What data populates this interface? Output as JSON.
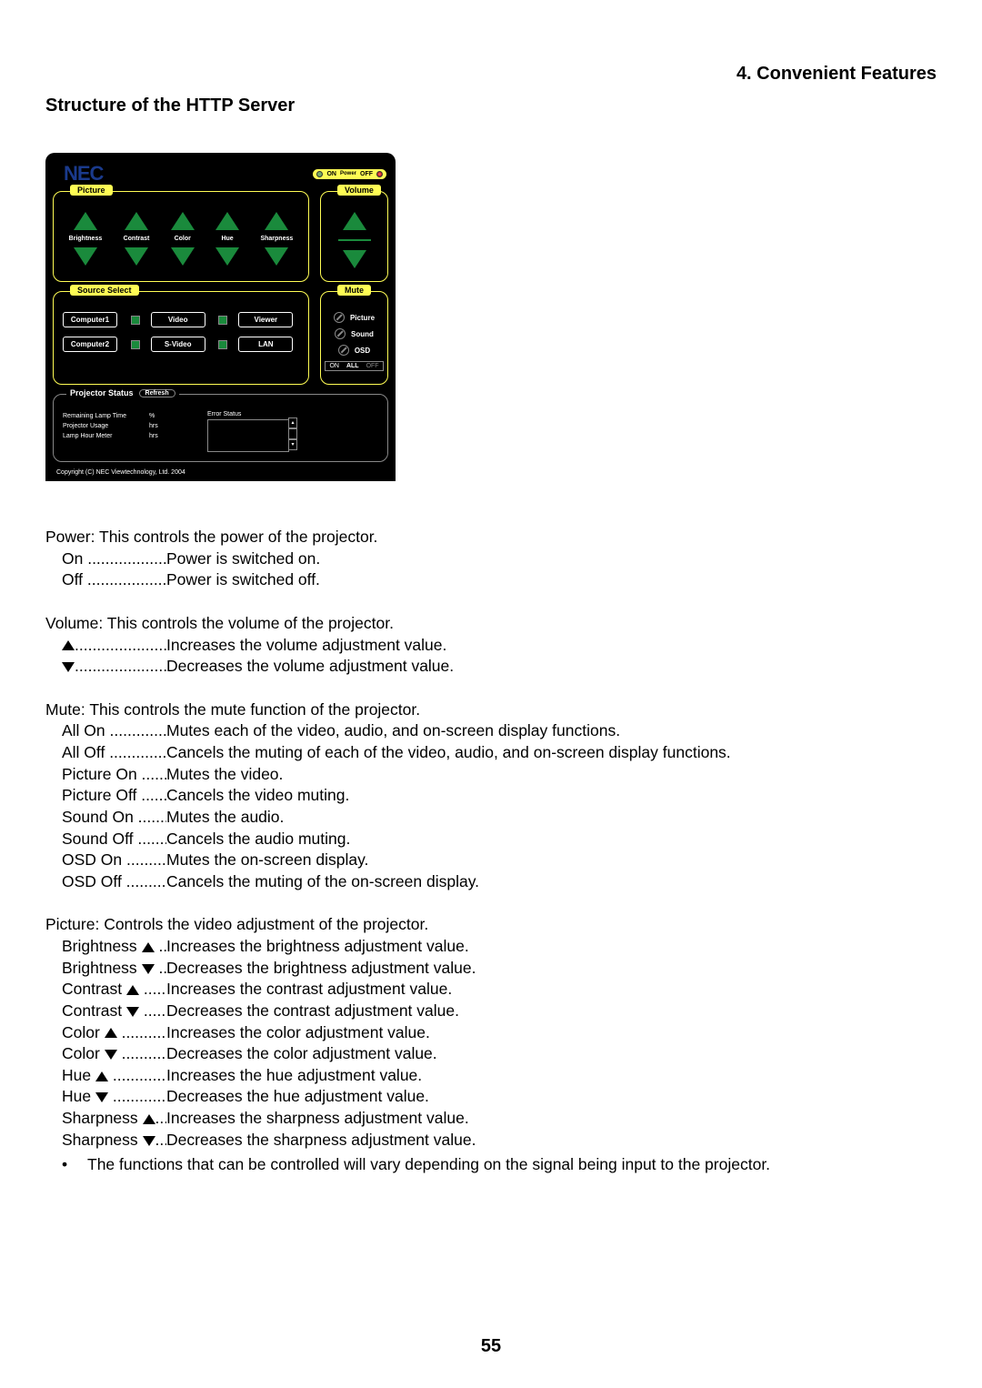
{
  "header": {
    "chapter": "4. Convenient Features",
    "section": "Structure of the HTTP Server"
  },
  "ui": {
    "logo": "NEC",
    "power": {
      "on": "ON",
      "label": "Power",
      "off": "OFF"
    },
    "picture": {
      "title": "Picture",
      "items": [
        "Brightness",
        "Contrast",
        "Color",
        "Hue",
        "Sharpness"
      ]
    },
    "volume": {
      "title": "Volume"
    },
    "source": {
      "title": "Source Select",
      "buttons": [
        "Computer1",
        "Video",
        "Viewer",
        "Computer2",
        "S-Video",
        "LAN"
      ]
    },
    "mute": {
      "title": "Mute",
      "items": [
        "Picture",
        "Sound",
        "OSD"
      ],
      "all": {
        "on": "ON",
        "all": "ALL",
        "off": "OFF"
      }
    },
    "status": {
      "title": "Projector Status",
      "refresh": "Refresh",
      "rows": [
        {
          "label": "Remaining Lamp Time",
          "unit": "%"
        },
        {
          "label": "Projector Usage",
          "unit": "hrs"
        },
        {
          "label": "Lamp Hour Meter",
          "unit": "hrs"
        }
      ],
      "error": "Error Status"
    },
    "copyright": "Copyright (C) NEC Viewtechnology, Ltd. 2004"
  },
  "text": {
    "power": {
      "head": "Power: This controls the power of the projector.",
      "rows": [
        {
          "term": "On ...................",
          "desc": "Power is switched on."
        },
        {
          "term": "Off ...................",
          "desc": "Power is switched off."
        }
      ]
    },
    "volume": {
      "head": "Volume: This controls the volume of the projector.",
      "rows": [
        {
          "sym": "up",
          "dots": ".....................",
          "desc": "Increases the volume adjustment value."
        },
        {
          "sym": "down",
          "dots": ".....................",
          "desc": "Decreases the volume adjustment value."
        }
      ]
    },
    "mute": {
      "head": "Mute: This controls the mute function of the projector.",
      "rows": [
        {
          "term": "All On ..............",
          "desc": "Mutes each of the video, audio, and on-screen display functions."
        },
        {
          "term": "All Off ..............",
          "desc": "Cancels the muting of each of the video, audio, and on-screen display functions."
        },
        {
          "term": "Picture On .......",
          "desc": "Mutes the video."
        },
        {
          "term": "Picture Off .......",
          "desc": "Cancels the video muting."
        },
        {
          "term": "Sound On ........",
          "desc": "Mutes the audio."
        },
        {
          "term": "Sound Off ........",
          "desc": "Cancels the audio muting."
        },
        {
          "term": "OSD On ..........",
          "desc": "Mutes the on-screen display."
        },
        {
          "term": "OSD Off ..........",
          "desc": "Cancels the muting of the on-screen display."
        }
      ]
    },
    "picture": {
      "head": "Picture: Controls the video adjustment of the projector.",
      "rows": [
        {
          "term": "Brightness",
          "sym": "up",
          "dots": "...",
          "desc": "Increases the brightness adjustment value."
        },
        {
          "term": "Brightness",
          "sym": "down",
          "dots": "...",
          "desc": "Decreases the brightness adjustment value."
        },
        {
          "term": "Contrast",
          "sym": "up",
          "dots": "......",
          "desc": "Increases the contrast adjustment value."
        },
        {
          "term": "Contrast",
          "sym": "down",
          "dots": "......",
          "desc": "Decreases the contrast adjustment value."
        },
        {
          "term": "Color",
          "sym": "up",
          "dots": "...........",
          "desc": "Increases the color adjustment value."
        },
        {
          "term": "Color",
          "sym": "down",
          "dots": "...........",
          "desc": "Decreases the color adjustment value."
        },
        {
          "term": "Hue",
          "sym": "up",
          "dots": ".............",
          "desc": "Increases the hue adjustment value."
        },
        {
          "term": "Hue",
          "sym": "down",
          "dots": ".............",
          "desc": "Decreases the hue adjustment value."
        },
        {
          "term": "Sharpness",
          "sym": "up",
          "dots": "...",
          "desc": "Increases the sharpness adjustment value."
        },
        {
          "term": "Sharpness",
          "sym": "down",
          "dots": "...",
          "desc": "Decreases the sharpness adjustment value."
        }
      ],
      "note": "The functions that can be controlled will vary depending on the signal being input to the projector."
    }
  },
  "page_number": "55"
}
